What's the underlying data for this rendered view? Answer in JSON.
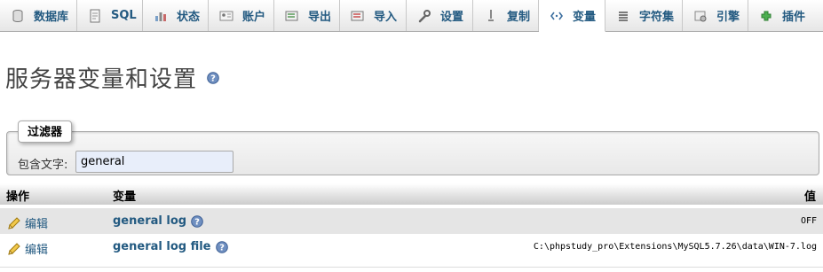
{
  "tabs": [
    {
      "label": "数据库",
      "icon": "database-icon",
      "active": false
    },
    {
      "label": "SQL",
      "icon": "sql-icon",
      "active": false
    },
    {
      "label": "状态",
      "icon": "status-icon",
      "active": false
    },
    {
      "label": "账户",
      "icon": "accounts-icon",
      "active": false
    },
    {
      "label": "导出",
      "icon": "export-icon",
      "active": false
    },
    {
      "label": "导入",
      "icon": "import-icon",
      "active": false
    },
    {
      "label": "设置",
      "icon": "settings-icon",
      "active": false
    },
    {
      "label": "复制",
      "icon": "replication-icon",
      "active": false
    },
    {
      "label": "变量",
      "icon": "variables-icon",
      "active": true
    },
    {
      "label": "字符集",
      "icon": "charset-icon",
      "active": false
    },
    {
      "label": "引擎",
      "icon": "engines-icon",
      "active": false
    },
    {
      "label": "插件",
      "icon": "plugins-icon",
      "active": false
    }
  ],
  "page": {
    "title": "服务器变量和设置"
  },
  "filter": {
    "legend": "过滤器",
    "label": "包含文字:",
    "value": "general"
  },
  "table": {
    "headers": {
      "action": "操作",
      "variable": "变量",
      "value": "值"
    },
    "rows": [
      {
        "edit_label": "编辑",
        "name": "general log",
        "value": "OFF"
      },
      {
        "edit_label": "编辑",
        "name": "general log file",
        "value": "C:\\phpstudy_pro\\Extensions\\MySQL5.7.26\\data\\WIN-7.log"
      }
    ]
  },
  "colors": {
    "link": "#235a81",
    "row_odd": "#e5e5e5",
    "input_bg": "#e8eefa"
  }
}
